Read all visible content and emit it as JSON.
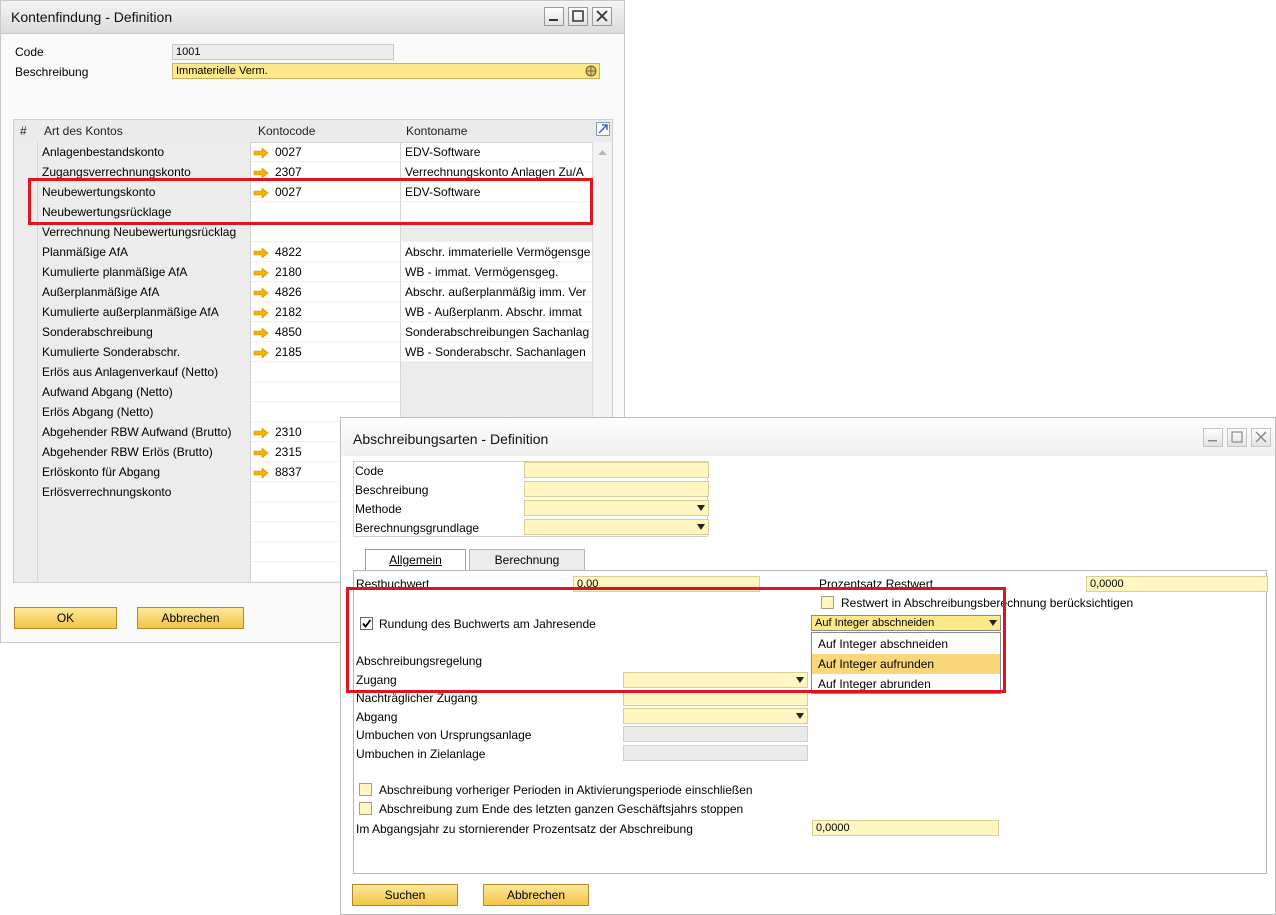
{
  "win1": {
    "title": "Kontenfindung - Definition",
    "code_label": "Code",
    "code_value": "1001",
    "desc_label": "Beschreibung",
    "desc_value": "Immaterielle Verm.",
    "columns": [
      "#",
      "Art des Kontos",
      "Kontocode",
      "Kontoname"
    ],
    "rows": [
      {
        "type": "Anlagenbestandskonto",
        "code": "0027",
        "name": "EDV-Software"
      },
      {
        "type": "Zugangsverrechnungskonto",
        "code": "2307",
        "name": "Verrechnungskonto Anlagen Zu/A"
      },
      {
        "type": "Neubewertungskonto",
        "code": "0027",
        "name": "EDV-Software"
      },
      {
        "type": "Neubewertungsrücklage",
        "code": "",
        "name": ""
      },
      {
        "type": "Verrechnung Neubewertungsrücklag",
        "code": "",
        "name": ""
      },
      {
        "type": "Planmäßige AfA",
        "code": "4822",
        "name": "Abschr. immaterielle Vermögensge"
      },
      {
        "type": "Kumulierte planmäßige AfA",
        "code": "2180",
        "name": "WB - immat. Vermögensgeg."
      },
      {
        "type": "Außerplanmäßige AfA",
        "code": "4826",
        "name": "Abschr. außerplanmäßig imm. Ver"
      },
      {
        "type": "Kumulierte außerplanmäßige AfA",
        "code": "2182",
        "name": "WB - Außerplanm. Abschr. immat"
      },
      {
        "type": "Sonderabschreibung",
        "code": "4850",
        "name": "Sonderabschreibungen Sachanlag"
      },
      {
        "type": "Kumulierte Sonderabschr.",
        "code": "2185",
        "name": "WB - Sonderabschr. Sachanlagen"
      },
      {
        "type": "Erlös aus Anlagenverkauf (Netto)",
        "code": "",
        "name": ""
      },
      {
        "type": "Aufwand Abgang (Netto)",
        "code": "",
        "name": ""
      },
      {
        "type": "Erlös Abgang (Netto)",
        "code": "",
        "name": ""
      },
      {
        "type": "Abgehender RBW Aufwand (Brutto)",
        "code": "2310",
        "name": ""
      },
      {
        "type": "Abgehender RBW Erlös (Brutto)",
        "code": "2315",
        "name": ""
      },
      {
        "type": "Erlöskonto für Abgang",
        "code": "8837",
        "name": ""
      },
      {
        "type": "Erlösverrechnungskonto",
        "code": "",
        "name": ""
      },
      {
        "type": "",
        "code": "",
        "name": ""
      },
      {
        "type": "",
        "code": "",
        "name": ""
      },
      {
        "type": "",
        "code": "",
        "name": ""
      },
      {
        "type": "",
        "code": "",
        "name": ""
      }
    ],
    "ok_label": "OK",
    "cancel_label": "Abbrechen"
  },
  "win2": {
    "title": "Abschreibungsarten - Definition",
    "code_label": "Code",
    "desc_label": "Beschreibung",
    "method_label": "Methode",
    "basis_label": "Berechnungsgrundlage",
    "tab_general": "Allgemein",
    "tab_calc": "Berechnung",
    "restbuchwert_label": "Restbuchwert",
    "restbuchwert_value": "0,00",
    "prozentsatz_label": "Prozentsatz Restwert",
    "prozentsatz_value": "0,0000",
    "restwert_check_label": "Restwert in Abschreibungsberechnung berücksichtigen",
    "rundung_label": "Rundung des Buchwerts am Jahresende",
    "rundung_selected": "Auf Integer abschneiden",
    "rundung_options": [
      "Auf Integer abschneiden",
      "Auf Integer aufrunden",
      "Auf Integer abrunden"
    ],
    "regelung_label": "Abschreibungsregelung",
    "zugang_label": "Zugang",
    "nachtr_label": "Nachträglicher Zugang",
    "abgang_label": "Abgang",
    "umbuchen_ursprung_label": "Umbuchen von Ursprungsanlage",
    "umbuchen_ziel_label": "Umbuchen in Zielanlage",
    "check1_label": "Abschreibung vorheriger Perioden in Aktivierungsperiode einschließen",
    "check2_label": "Abschreibung zum Ende des letzten ganzen Geschäftsjahrs stoppen",
    "storno_label": "Im Abgangsjahr zu stornierender Prozentsatz der Abschreibung",
    "storno_value": "0,0000",
    "search_label": "Suchen",
    "cancel_label": "Abbrechen"
  },
  "colors": {
    "highlight_red": "#e0141e",
    "field_yellow": "#fff6c2",
    "button_gold": "#f3c447",
    "arrow_gold": "#f0b400"
  }
}
